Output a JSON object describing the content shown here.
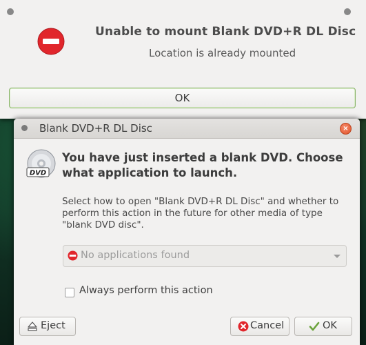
{
  "error_dialog": {
    "title": "Unable to mount Blank DVD+R DL Disc",
    "message": "Location is already mounted",
    "ok_label": "OK"
  },
  "autorun_dialog": {
    "window_title": "Blank DVD+R DL Disc",
    "heading": "You have just inserted a blank DVD. Choose what application to launch.",
    "description": "Select how to open \"Blank DVD+R DL Disc\" and whether to perform this action in the future for other media of type \"blank DVD disc\".",
    "app_select_value": "No applications found",
    "always_perform_label": "Always perform this action",
    "always_perform_checked": false,
    "eject_label": "Eject",
    "cancel_label": "Cancel",
    "ok_label": "OK",
    "icon_text": "DVD"
  },
  "icons": [
    "stop-icon",
    "dvd-disc-icon",
    "eject-icon",
    "cancel-icon",
    "checkmark-icon",
    "close-icon"
  ],
  "colors": {
    "error_red": "#e1262c",
    "ok_green": "#6aa23a",
    "close_orange": "#e2542a"
  }
}
